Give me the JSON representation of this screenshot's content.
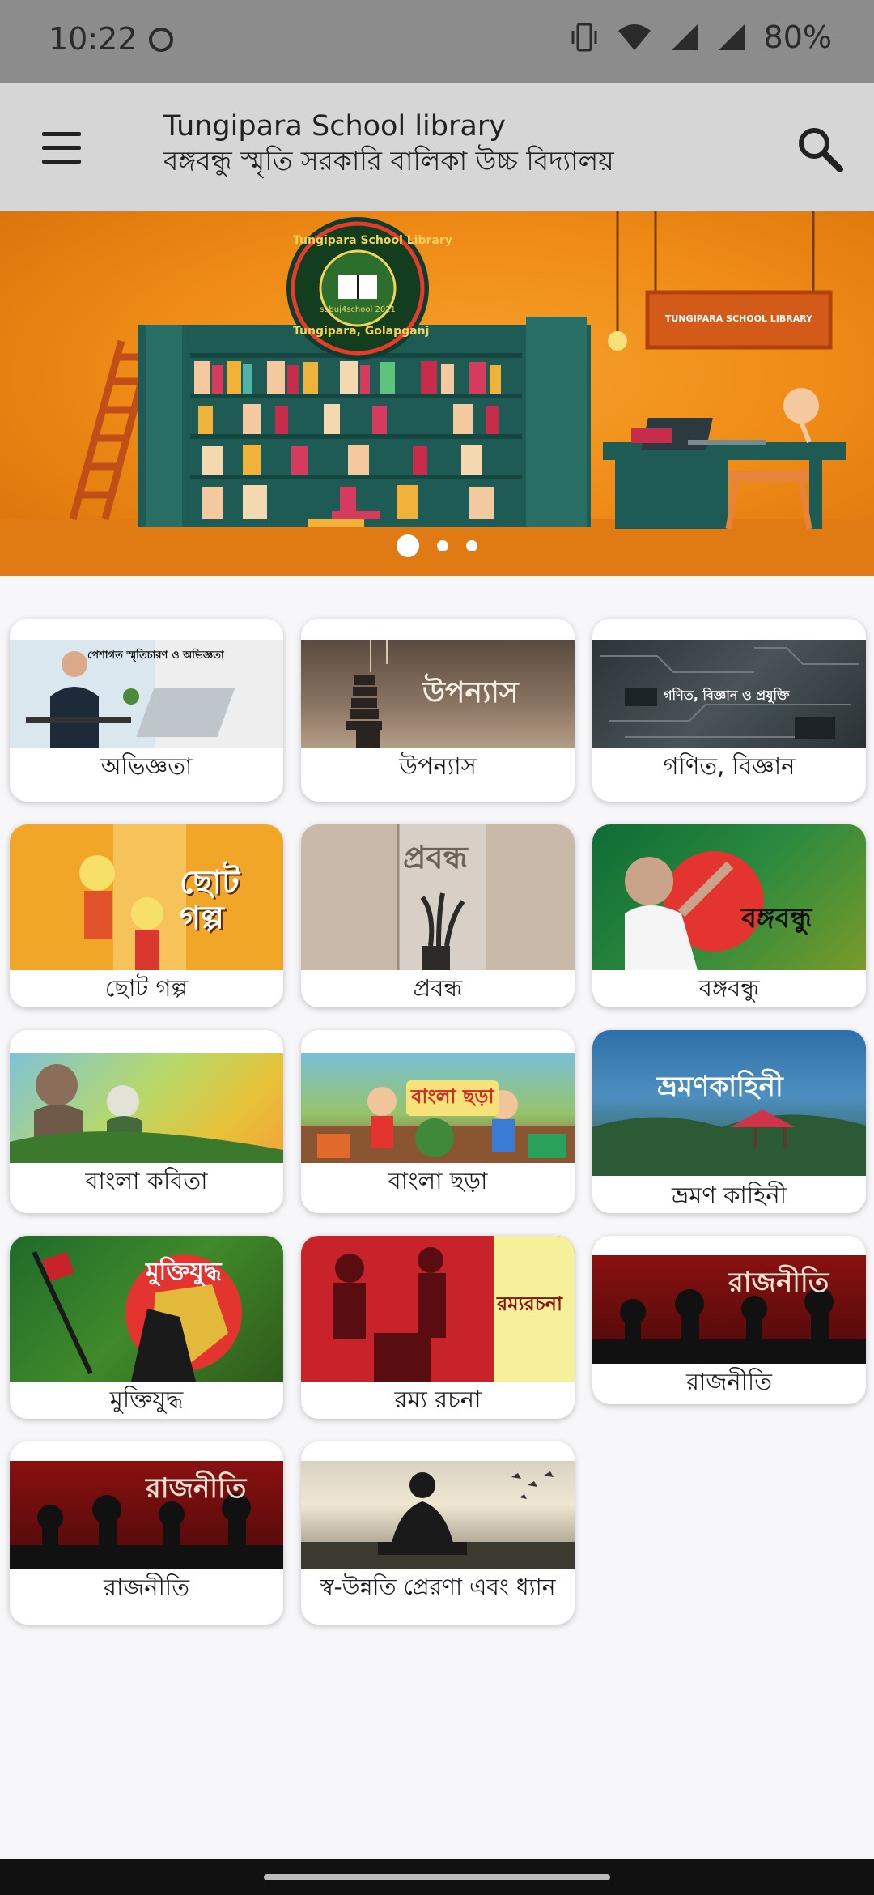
{
  "status": {
    "time": "10:22",
    "battery": "80%"
  },
  "app_bar": {
    "title": "Tungipara School library",
    "subtitle": "বঙ্গবন্ধু স্মৃতি সরকারি বালিকা উচ্চ বিদ্যালয়"
  },
  "banner": {
    "logo_text_top": "Tungipara School Library",
    "logo_text_bottom": "Tungipara, Golapganj",
    "logo_year": "sabuj4school 2021",
    "sign_text": "TUNGIPARA SCHOOL LIBRARY",
    "slides": 3,
    "active_slide": 1
  },
  "categories": [
    {
      "label": "অভিজ্ঞতা",
      "image_text": "পেশাগত স্মৃতিচারণ ও অভিজ্ঞতা"
    },
    {
      "label": "উপন্যাস",
      "image_text": "উপন্যাস"
    },
    {
      "label": "গণিত, বিজ্ঞান",
      "image_text": "গণিত, বিজ্ঞান ও প্রযুক্তি"
    },
    {
      "label": "ছোট গল্প",
      "image_text": "ছোট গল্প"
    },
    {
      "label": "প্রবন্ধ",
      "image_text": "প্রবন্ধ"
    },
    {
      "label": "বঙ্গবন্ধু",
      "image_text": "বঙ্গবন্ধু"
    },
    {
      "label": "বাংলা কবিতা",
      "image_text": ""
    },
    {
      "label": "বাংলা ছড়া",
      "image_text": "বাংলা ছড়া"
    },
    {
      "label": "ভ্রমণ কাহিনী",
      "image_text": "ভ্রমণকাহিনী"
    },
    {
      "label": "মুক্তিযুদ্ধ",
      "image_text": "মুক্তিযুদ্ধ"
    },
    {
      "label": "রম্য রচনা",
      "image_text": "রম্যরচনা"
    },
    {
      "label": "রাজনীতি",
      "image_text": "রাজনীতি"
    },
    {
      "label": "রাজনীতি",
      "image_text": "রাজনীতি"
    },
    {
      "label": "স্ব-উন্নতি প্রেরণা এবং ধ্যান",
      "image_text": ""
    }
  ]
}
